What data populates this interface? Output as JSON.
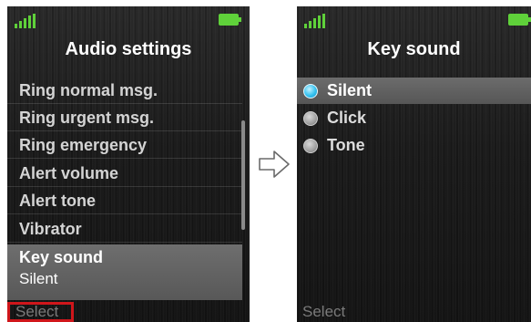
{
  "left_screen": {
    "title": "Audio settings",
    "menu_items": [
      {
        "label": "Ring normal msg."
      },
      {
        "label": "Ring urgent msg."
      },
      {
        "label": "Ring emergency"
      },
      {
        "label": "Alert volume"
      },
      {
        "label": "Alert tone"
      },
      {
        "label": "Vibrator"
      }
    ],
    "selected_item": {
      "label": "Key sound",
      "value": "Silent"
    },
    "softkey": "Select"
  },
  "right_screen": {
    "title": "Key sound",
    "options": [
      {
        "label": "Silent",
        "checked": true
      },
      {
        "label": "Click",
        "checked": false
      },
      {
        "label": "Tone",
        "checked": false
      }
    ],
    "softkey": "Select"
  },
  "colors": {
    "signal": "#5fd13a",
    "battery": "#5fd13a",
    "highlight_box": "#d0161b",
    "radio_checked": "#35c2f0"
  },
  "icons": {
    "signal": "signal-strength-icon",
    "battery": "battery-icon",
    "arrow": "right-arrow-icon"
  }
}
